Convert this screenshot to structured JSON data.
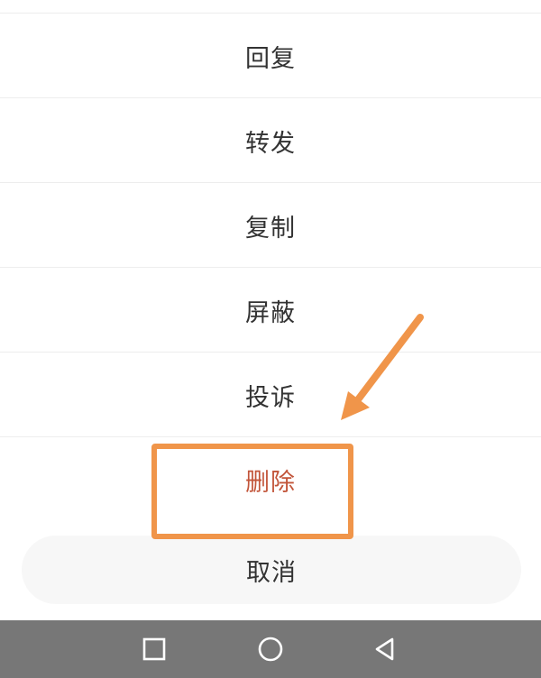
{
  "action_sheet": {
    "items": [
      {
        "label": "回复"
      },
      {
        "label": "转发"
      },
      {
        "label": "复制"
      },
      {
        "label": "屏蔽"
      },
      {
        "label": "投诉"
      },
      {
        "label": "删除"
      }
    ],
    "cancel_label": "取消"
  },
  "colors": {
    "text": "#333333",
    "delete_text": "#c2553a",
    "annotation": "#f0954a",
    "nav_bar": "#777777"
  },
  "nav_bar": {
    "buttons": [
      {
        "icon": "square-recents-icon"
      },
      {
        "icon": "circle-home-icon"
      },
      {
        "icon": "triangle-back-icon"
      }
    ]
  }
}
